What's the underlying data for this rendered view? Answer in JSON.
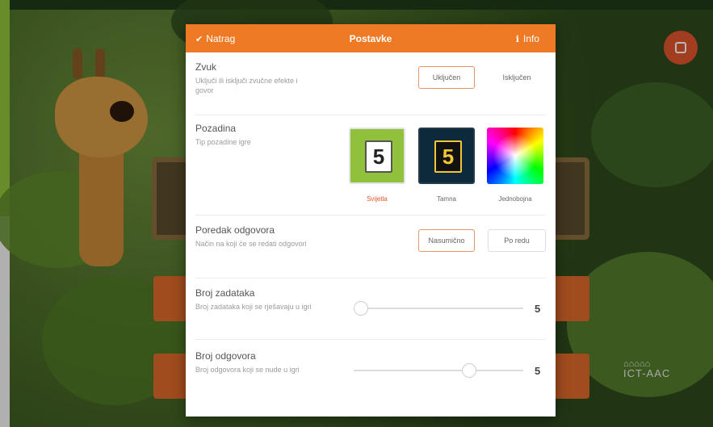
{
  "header": {
    "back_label": "Natrag",
    "title": "Postavke",
    "info_label": "Info"
  },
  "sections": {
    "sound": {
      "title": "Zvuk",
      "description": "Uključi ili isključi zvučne efekte i govor",
      "options": [
        "Uključen",
        "Isključen"
      ],
      "selected": "Uključen"
    },
    "background": {
      "title": "Pozadina",
      "description": "Tip pozadine igre",
      "themes": [
        {
          "label": "Svijetla",
          "card_value": "5",
          "icon": "light-theme-icon",
          "selected": true
        },
        {
          "label": "Tamna",
          "card_value": "5",
          "icon": "dark-theme-icon",
          "selected": false
        },
        {
          "label": "Jednobojna",
          "card_value": "",
          "icon": "color-wheel-icon",
          "selected": false
        }
      ]
    },
    "answer_order": {
      "title": "Poredak odgovora",
      "description": "Način na koji će se redati odgovori",
      "options": [
        "Nasumično",
        "Po redu"
      ],
      "selected": "Nasumično"
    },
    "task_count": {
      "title": "Broj zadataka",
      "description": "Broj zadataka koji se rješavaju u igri",
      "value": "5",
      "level": 0.0
    },
    "answer_count": {
      "title": "Broj odgovora",
      "description": "Broj odgovora koji se nude u igri",
      "value": "5",
      "level": 0.7
    }
  },
  "branding": {
    "text": "ICT-AAC"
  },
  "colors": {
    "accent": "#ef7a26",
    "fab": "#e2552b",
    "selected_border": "#e8946a"
  }
}
